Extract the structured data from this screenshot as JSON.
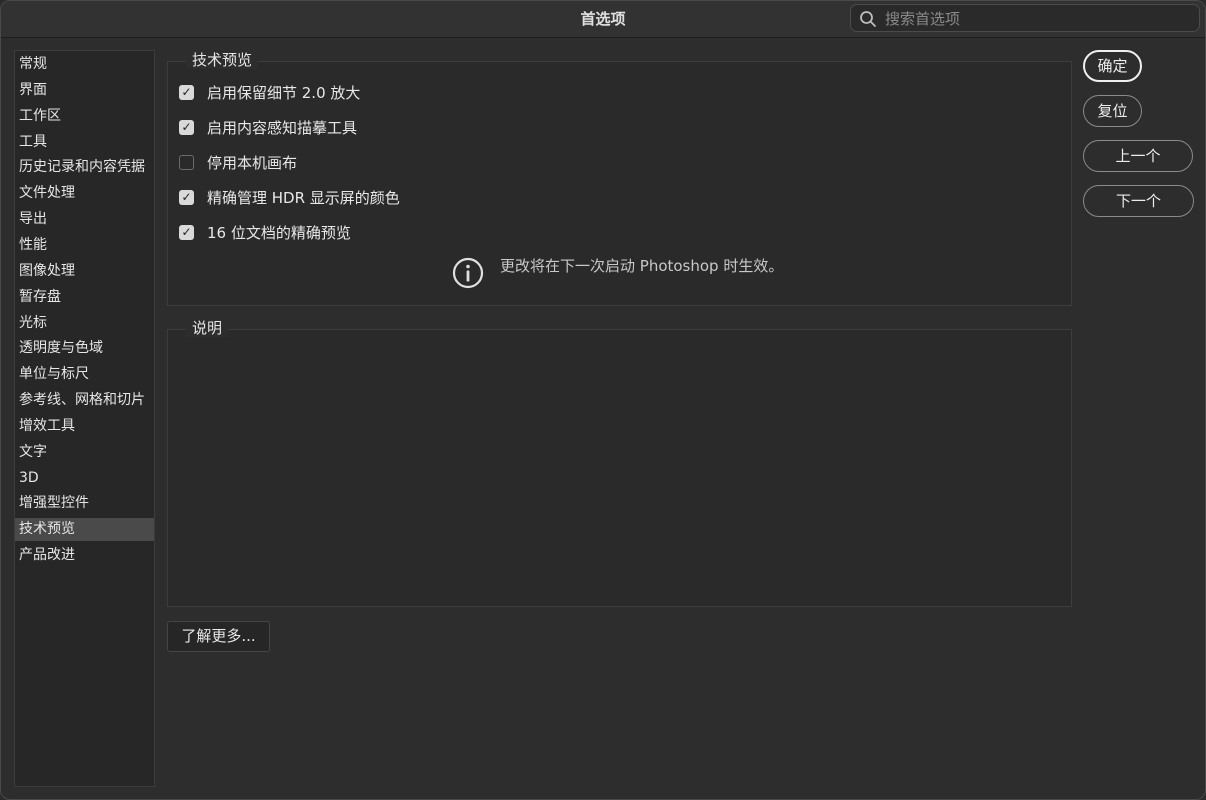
{
  "window": {
    "title": "首选项",
    "search_placeholder": "搜索首选项"
  },
  "sidebar": {
    "items": [
      {
        "label": "常规"
      },
      {
        "label": "界面"
      },
      {
        "label": "工作区"
      },
      {
        "label": "工具"
      },
      {
        "label": "历史记录和内容凭据"
      },
      {
        "label": "文件处理"
      },
      {
        "label": "导出"
      },
      {
        "label": "性能"
      },
      {
        "label": "图像处理"
      },
      {
        "label": "暂存盘"
      },
      {
        "label": "光标"
      },
      {
        "label": "透明度与色域"
      },
      {
        "label": "单位与标尺"
      },
      {
        "label": "参考线、网格和切片"
      },
      {
        "label": "增效工具"
      },
      {
        "label": "文字"
      },
      {
        "label": "3D"
      },
      {
        "label": "增强型控件"
      },
      {
        "label": "技术预览"
      },
      {
        "label": "产品改进"
      }
    ],
    "selected": "技术预览"
  },
  "tech_preview": {
    "group_title": "技术预览",
    "options": [
      {
        "label": "启用保留细节 2.0 放大",
        "checked": true
      },
      {
        "label": "启用内容感知描摹工具",
        "checked": true
      },
      {
        "label": "停用本机画布",
        "checked": false
      },
      {
        "label": "精确管理 HDR 显示屏的颜色",
        "checked": true
      },
      {
        "label": "16 位文档的精确预览",
        "checked": true
      }
    ],
    "notice": "更改将在下一次启动 Photoshop 时生效。"
  },
  "description": {
    "group_title": "说明"
  },
  "learn_more_label": "了解更多...",
  "buttons": {
    "ok": "确定",
    "reset": "复位",
    "prev": "上一个",
    "next": "下一个"
  },
  "colors": {
    "background": "#2d2d2d",
    "selected_item": "#4a4a4a",
    "text": "#e8e8e8"
  }
}
